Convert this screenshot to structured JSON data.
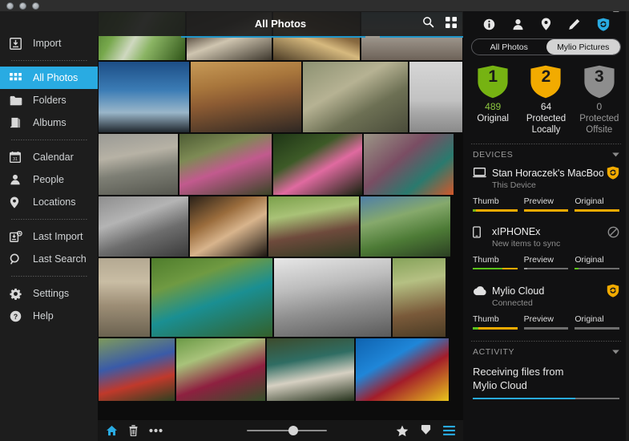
{
  "window": {
    "traffic_lights": [
      "close",
      "minimize",
      "zoom"
    ]
  },
  "sidebar": {
    "items": [
      {
        "label": "Import",
        "icon": "import-icon",
        "active": false
      },
      {
        "label": "All Photos",
        "icon": "grid-icon",
        "active": true
      },
      {
        "label": "Folders",
        "icon": "folder-icon",
        "active": false
      },
      {
        "label": "Albums",
        "icon": "albums-icon",
        "active": false
      },
      {
        "label": "Calendar",
        "icon": "calendar-icon",
        "active": false
      },
      {
        "label": "People",
        "icon": "person-icon",
        "active": false
      },
      {
        "label": "Locations",
        "icon": "location-pin-icon",
        "active": false
      },
      {
        "label": "Last Import",
        "icon": "last-import-icon",
        "active": false
      },
      {
        "label": "Last Search",
        "icon": "search-icon",
        "active": false
      },
      {
        "label": "Settings",
        "icon": "gear-icon",
        "active": false
      },
      {
        "label": "Help",
        "icon": "help-icon",
        "active": false
      }
    ]
  },
  "main": {
    "header": {
      "title": "All Photos",
      "icons": [
        "search-icon",
        "grid-view-icon"
      ]
    },
    "bottom_toolbar": {
      "left_icons": [
        "home-icon",
        "trash-icon",
        "more-icon"
      ],
      "right_icons": [
        "star-icon",
        "download-icon",
        "list-menu-icon"
      ],
      "zoom_slider_value": 52
    }
  },
  "right_panel": {
    "top_icons": [
      "info-icon",
      "person-icon",
      "location-pin-icon",
      "pencil-icon",
      "shield-sync-icon"
    ],
    "segmented": {
      "options": [
        "All Photos",
        "Mylio Pictures"
      ],
      "selected": "Mylio Pictures"
    },
    "stats": [
      {
        "badge": "1",
        "count": "489",
        "label": "Original",
        "color": "#76b312",
        "count_color": "#8cc63f"
      },
      {
        "badge": "2",
        "count": "64",
        "label": "Protected Locally",
        "color": "#f2ab00",
        "count_color": "#e8e8e8"
      },
      {
        "badge": "3",
        "count": "0",
        "label": "Protected Offsite",
        "color": "#8d8d8d",
        "count_color": "#9a9a9a"
      }
    ],
    "devices_section": {
      "title": "DEVICES",
      "collapse_icon": "chevron-down-icon",
      "devices": [
        {
          "name": "Stan Horaczek's MacBook...",
          "status": "This Device",
          "icon": "laptop-icon",
          "badge": "shield-sync-icon",
          "badge_color": "#f2ab00",
          "bars": [
            {
              "label": "Thumb",
              "segments": [
                {
                  "color": "#76b312",
                  "pct": 7
                },
                {
                  "color": "#f2ab00",
                  "pct": 93
                }
              ]
            },
            {
              "label": "Preview",
              "segments": [
                {
                  "color": "#f2ab00",
                  "pct": 100
                }
              ]
            },
            {
              "label": "Original",
              "segments": [
                {
                  "color": "#f2ab00",
                  "pct": 100
                }
              ]
            }
          ]
        },
        {
          "name": "xIPHONEx",
          "status": "New items to sync",
          "icon": "phone-icon",
          "badge": "blocked-icon",
          "badge_color": "#8d8d8d",
          "bars": [
            {
              "label": "Thumb",
              "segments": [
                {
                  "color": "#5cc21b",
                  "pct": 66
                },
                {
                  "color": "#f2ab00",
                  "pct": 34
                }
              ]
            },
            {
              "label": "Preview",
              "segments": [
                {
                  "color": "#9a9a9a",
                  "pct": 8
                }
              ]
            },
            {
              "label": "Original",
              "segments": [
                {
                  "color": "#5cc21b",
                  "pct": 9
                }
              ]
            }
          ]
        },
        {
          "name": "Mylio Cloud",
          "status": "Connected",
          "icon": "cloud-icon",
          "badge": "shield-sync-icon",
          "badge_color": "#f2ab00",
          "bars": [
            {
              "label": "Thumb",
              "segments": [
                {
                  "color": "#5cc21b",
                  "pct": 13
                },
                {
                  "color": "#f2ab00",
                  "pct": 87
                }
              ]
            },
            {
              "label": "Preview",
              "segments": []
            },
            {
              "label": "Original",
              "segments": []
            }
          ]
        }
      ]
    },
    "activity_section": {
      "title": "ACTIVITY",
      "collapse_icon": "chevron-down-icon",
      "message_line1": "Receiving files from",
      "message_line2": "Mylio Cloud",
      "progress_pct": 70
    }
  },
  "photo_grid": {
    "rows": [
      {
        "height": 62,
        "cells": [
          {
            "w": 110,
            "name": "photo-green-blur",
            "css": "linear-gradient(120deg,#4a7a2a 0%,#77a84c 25%,#cfd8c0 45%,#8ab463 62%,#2f5418 100%)"
          },
          {
            "w": 108,
            "name": "photo-debris-ground",
            "css": "linear-gradient(160deg,#4b4338 0%,#6d6254 35%,#cfc5b0 55%,#3e382e 100%)"
          },
          {
            "w": 110,
            "name": "photo-road-sunset",
            "css": "linear-gradient(200deg,#3a2f22 0%,#8a6b41 40%,#d6b97e 58%,#4a3a24 100%)"
          },
          {
            "w": 128,
            "name": "photo-dog-on-gravel",
            "css": "linear-gradient(180deg,#7fb4cf 0%,#b9c7c4 34%,#9a9288 55%,#6d6258 100%)"
          }
        ]
      },
      {
        "height": 90,
        "cells": [
          {
            "w": 115,
            "name": "photo-blue-sky-dusk",
            "css": "linear-gradient(180deg,#1d4e86 0%,#3b7cb5 40%,#9ab6c9 72%,#20272e 100%)"
          },
          {
            "w": 140,
            "name": "photo-bearded-man",
            "css": "linear-gradient(170deg,#c79a57 0%,#a8763c 32%,#8c5b33 52%,#2e2723 100%)"
          },
          {
            "w": 133,
            "name": "photo-kids-outdoors",
            "css": "linear-gradient(150deg,#8d9272 0%,#b6b293 38%,#6d7054 65%,#4a4c3a 100%)"
          },
          {
            "w": 68,
            "name": "photo-bw-child-running",
            "css": "linear-gradient(180deg,#d6d6d6 0%,#c2c2c2 55%,#a8a8a8 72%,#8a8a8a 100%)"
          }
        ]
      },
      {
        "height": 78,
        "cells": [
          {
            "w": 101,
            "name": "photo-family-playground",
            "css": "linear-gradient(170deg,#9a9a95 0%,#b7b2a5 35%,#7e7f75 60%,#55564e 100%)"
          },
          {
            "w": 117,
            "name": "photo-girl-on-swing",
            "css": "linear-gradient(160deg,#4e5d34 0%,#7d8a54 30%,#c25a8e 55%,#3a4426 100%)"
          },
          {
            "w": 113,
            "name": "photo-girl-in-bush",
            "css": "linear-gradient(150deg,#1e3516 0%,#3d5a27 35%,#e06aa0 58%,#16230f 100%)"
          },
          {
            "w": 114,
            "name": "photo-woman-slide",
            "css": "linear-gradient(140deg,#9b9586 0%,#7a4d63 40%,#2a7a6e 70%,#d2572a 100%)"
          }
        ]
      },
      {
        "height": 77,
        "cells": [
          {
            "w": 114,
            "name": "photo-bw-alley-child",
            "css": "linear-gradient(160deg,#8e8e8e 0%,#b4b4b4 35%,#6d6d6d 62%,#3a3a3a 100%)"
          },
          {
            "w": 98,
            "name": "photo-dad-and-kids",
            "css": "linear-gradient(150deg,#2a2118 0%,#9a6c3c 35%,#d8b48c 58%,#1d1712 100%)"
          },
          {
            "w": 115,
            "name": "photo-mom-two-kids",
            "css": "linear-gradient(170deg,#7aa04a 0%,#a9c277 30%,#6e4a3c 60%,#2e3a20 100%)"
          },
          {
            "w": 114,
            "name": "photo-boy-superman-shirt",
            "css": "linear-gradient(165deg,#4e7fa8 0%,#86a96c 35%,#4d7b36 65%,#2b3f22 100%)"
          }
        ]
      },
      {
        "height": 100,
        "cells": [
          {
            "w": 66,
            "name": "photo-girl-puddle-reflection",
            "css": "linear-gradient(180deg,#b4a992 0%,#c9bda4 30%,#9d8e76 60%,#6b6250 100%)"
          },
          {
            "w": 153,
            "name": "photo-boy-lying-grass",
            "css": "linear-gradient(160deg,#4f7d2c 0%,#6f9a42 28%,#1a8f92 55%,#33602a 100%)"
          },
          {
            "w": 148,
            "name": "photo-bw-girl-eating",
            "css": "linear-gradient(170deg,#e7e7e7 0%,#bdbdbd 35%,#8f8f8f 62%,#5a5a5a 100%)"
          },
          {
            "w": 68,
            "name": "photo-girl-on-stump",
            "css": "linear-gradient(170deg,#86a35a 0%,#b5c083 30%,#7a5a3a 68%,#4a3b24 100%)"
          }
        ]
      },
      {
        "height": 80,
        "cells": [
          {
            "w": 97,
            "name": "photo-two-kids-flowers",
            "css": "linear-gradient(165deg,#7e9a5c 0%,#3a5ba8 40%,#c0392b 68%,#2c4020 100%)"
          },
          {
            "w": 113,
            "name": "photo-girl-running-party",
            "css": "linear-gradient(160deg,#6b9a46 0%,#a8c27a 30%,#8e2040 62%,#35502a 100%)"
          },
          {
            "w": 111,
            "name": "photo-toddler-in-chair",
            "css": "linear-gradient(170deg,#3d4b2c 0%,#2f6d63 35%,#d6d0c2 62%,#25321c 100%)"
          },
          {
            "w": 118,
            "name": "photo-boy-on-blue-slide",
            "css": "linear-gradient(150deg,#0f63b0 0%,#1f86d8 35%,#a31d2a 60%,#e8c41c 100%)"
          }
        ]
      }
    ]
  }
}
